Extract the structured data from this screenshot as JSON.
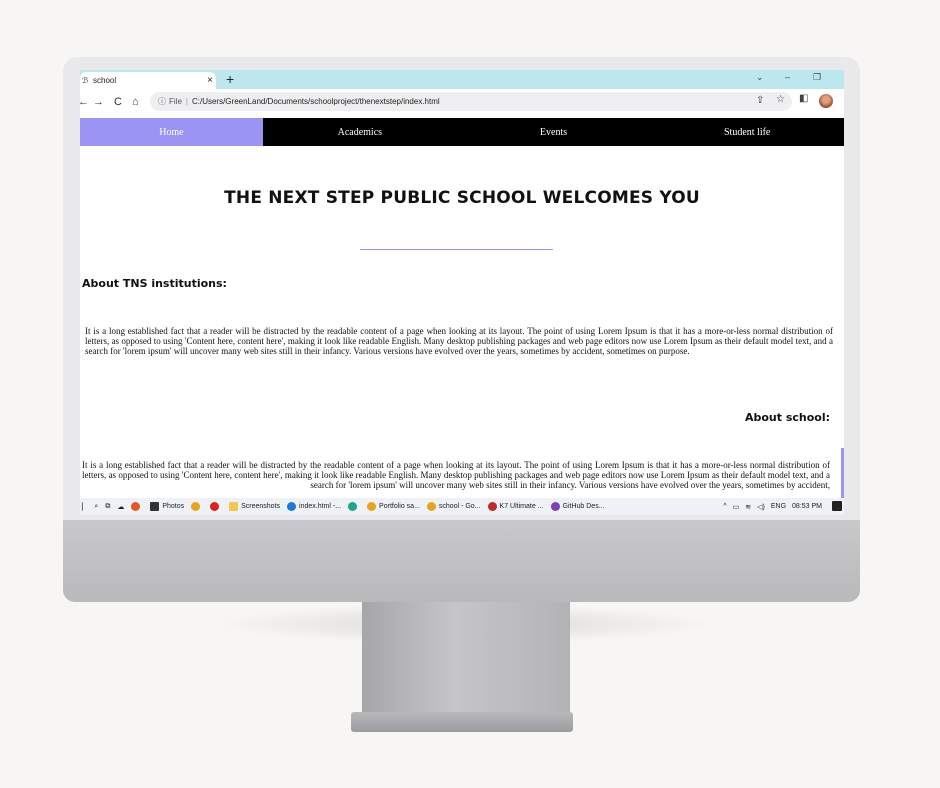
{
  "browser": {
    "tab_title": "school",
    "tab_close": "×",
    "new_tab": "+",
    "favicon": "ℬ",
    "controls": {
      "collapse": "⌄",
      "minimize": "–",
      "restore": "❐"
    },
    "nav_icons": {
      "back": "←",
      "forward": "→",
      "reload": "C",
      "home": "⌂"
    },
    "address": {
      "info_icon": "ⓘ",
      "scheme": "File",
      "separator": "|",
      "url": "C:/Users/GreenLand/Documents/schoolproject/thenextstep/index.html"
    },
    "right_icons": {
      "share": "⇪",
      "bookmark": "☆",
      "sidepanel": "◧"
    }
  },
  "site": {
    "nav": [
      "Home",
      "Academics",
      "Events",
      "Student life"
    ],
    "active_nav": "Home",
    "hero_title": "THE NEXT STEP PUBLIC SCHOOL WELCOMES YOU",
    "about_tns_heading": "About TNS institutions:",
    "about_tns_text": "It is a long established fact that a reader will be distracted by the readable content of a page when looking at its layout. The point of using Lorem Ipsum is that it has a more-or-less normal distribution of letters, as opposed to using 'Content here, content here', making it look like readable English. Many desktop publishing packages and web page editors now use Lorem Ipsum as their default model text, and a search for 'lorem ipsum' will uncover many web sites still in their infancy. Various versions have evolved over the years, sometimes by accident, sometimes on purpose.",
    "about_school_heading": "About school:",
    "about_school_text": "It is a long established fact that a reader will be distracted by the readable content of a page when looking at its layout. The point of using Lorem Ipsum is that it has a more-or-less normal distribution of letters, as opposed to using 'Content here, content here', making it look like readable English. Many desktop publishing packages and web page editors now use Lorem Ipsum as their default model text, and a search for 'lorem ipsum' will uncover many web sites still in their infancy. Various versions have evolved over the years, sometimes by accident,",
    "accent_color": "#9a95f2"
  },
  "taskbar": {
    "items": [
      {
        "label": "Photos",
        "icon": "photos-icon",
        "color": "#333333"
      },
      {
        "label": "",
        "icon": "chrome-icon",
        "color": "#e8a419"
      },
      {
        "label": "",
        "icon": "opera-icon",
        "color": "#d9231f"
      },
      {
        "label": "Screenshots",
        "icon": "folder-icon",
        "color": "#f2c94c"
      },
      {
        "label": "index.html -...",
        "icon": "vscode-icon",
        "color": "#1f7ad6"
      },
      {
        "label": "",
        "icon": "edge-icon",
        "color": "#1fa58a"
      },
      {
        "label": "Portfolio sa...",
        "icon": "chrome-icon",
        "color": "#e8a419"
      },
      {
        "label": "school - Go...",
        "icon": "chrome-icon",
        "color": "#e8a419"
      },
      {
        "label": "K7 Ultimate ...",
        "icon": "k7-icon",
        "color": "#c02a2a"
      },
      {
        "label": "GitHub Des...",
        "icon": "github-icon",
        "color": "#7d3fb8"
      }
    ],
    "tray": {
      "lang": "ENG",
      "time": "08:53 PM",
      "chevron": "^"
    }
  }
}
